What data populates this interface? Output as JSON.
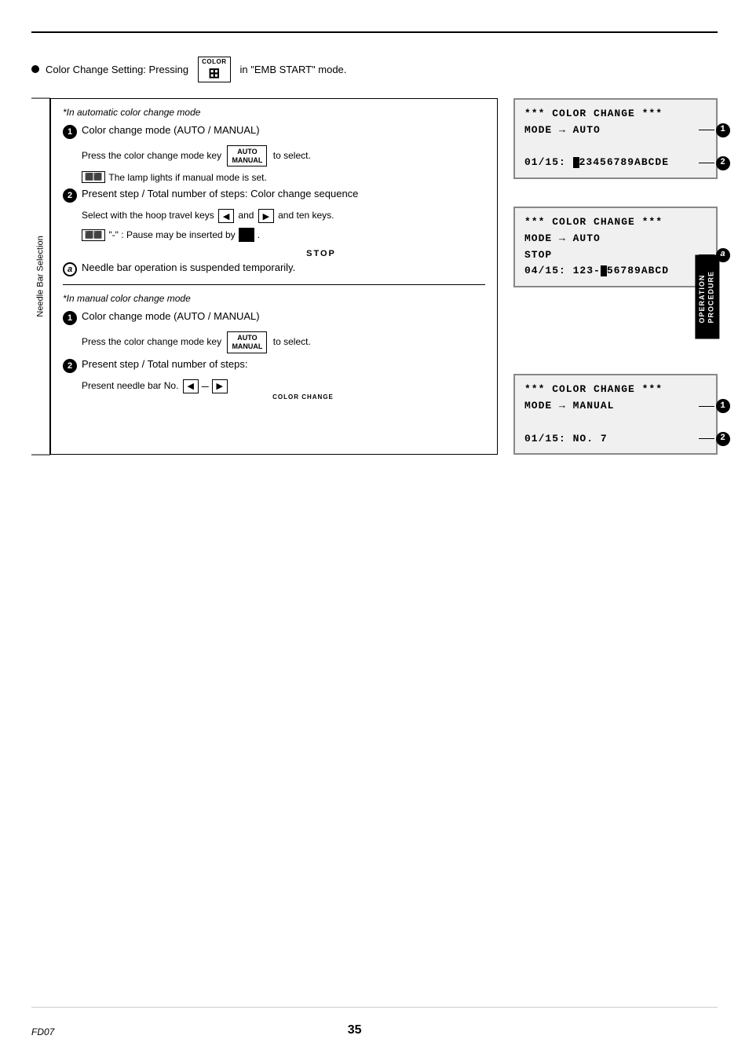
{
  "header": {
    "top_line": "Color Change Setting: Pressing",
    "key_label_top": "COLOR",
    "key_label_bottom": "",
    "suffix": "in \"EMB START\" mode."
  },
  "needle_bar_label": "Needle Bar Selection",
  "sections": {
    "auto_mode": {
      "title": "*In automatic color change mode",
      "steps": [
        {
          "number": "1",
          "text": "Color change mode (AUTO / MANUAL)",
          "sub": "Press the color change mode key",
          "key": "AUTO/MANUAL",
          "sub_suffix": "to select."
        },
        {
          "note": "The lamp lights if manual mode is set."
        },
        {
          "number": "2",
          "text": "Present step / Total number of steps: Color change sequence",
          "sub": "Select with the hoop travel keys",
          "sub_mid": "and",
          "sub_suffix": "and ten keys."
        },
        {
          "note": "\"-\" : Pause may be inserted by",
          "note_suffix": "."
        },
        {
          "stop_label": "STOP"
        },
        {
          "letter": "a",
          "text": "Needle bar operation is suspended temporarily."
        }
      ]
    },
    "manual_mode": {
      "title": "*In manual color change mode",
      "steps": [
        {
          "number": "1",
          "text": "Color change mode (AUTO / MANUAL)",
          "sub": "Press the color change mode key",
          "key": "AUTO/MANUAL",
          "sub_suffix": "to select."
        },
        {
          "number": "2",
          "text": "Present step / Total number of steps:",
          "sub": "Present needle bar No."
        }
      ]
    }
  },
  "lcd_screens": {
    "auto1": {
      "line1": "*** COLOR CHANGE ***",
      "line2": "MODE  → AUTO",
      "line3": "",
      "line4": "01/15: 123456789ABCDE",
      "callouts": [
        {
          "id": "1",
          "line": 2
        },
        {
          "id": "2",
          "line": 4
        }
      ]
    },
    "auto2": {
      "line1": "*** COLOR CHANGE ***",
      "line2": "MODE  → AUTO",
      "line3": "       STOP",
      "line4": "04/15: 123-456789ABCD",
      "callouts": [
        {
          "id": "a",
          "line": 3
        }
      ]
    },
    "manual1": {
      "line1": "*** COLOR CHANGE ***",
      "line2": "MODE  → MANUAL",
      "line3": "",
      "line4": "01/15:  NO. 7",
      "callouts": [
        {
          "id": "1",
          "line": 2
        },
        {
          "id": "2",
          "line": 4
        }
      ]
    }
  },
  "side_tab": {
    "line1": "OPERATION",
    "line2": "PROCEDURE"
  },
  "footer": {
    "code": "FD07",
    "page": "35"
  }
}
